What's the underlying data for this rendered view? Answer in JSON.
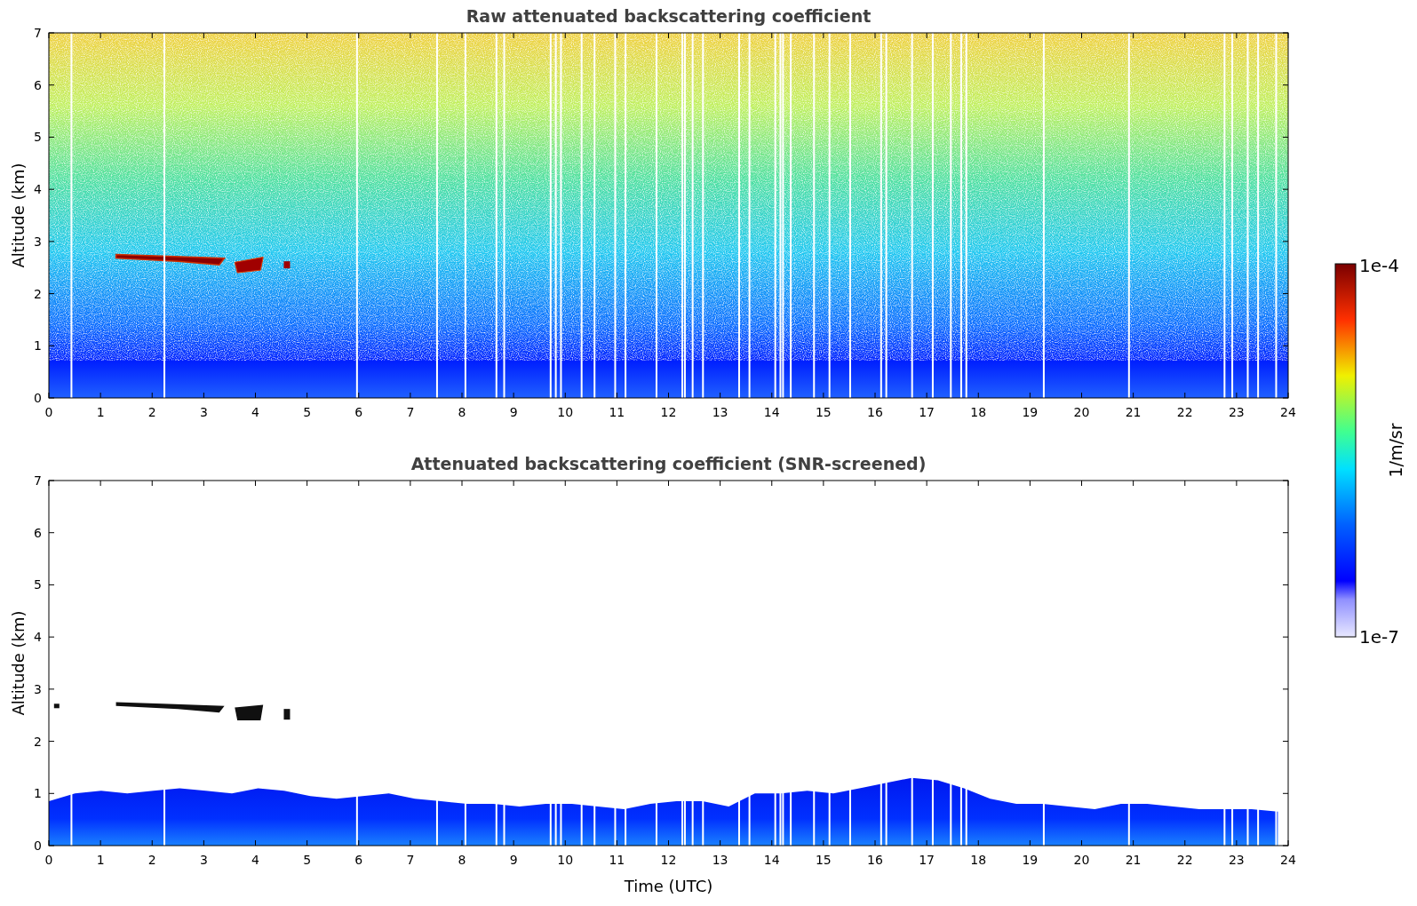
{
  "panels": [
    {
      "kind": "raw",
      "title": "Raw attenuated backscattering coefficient",
      "ylabel": "Altitude (km)",
      "yticks": [
        "7",
        "6",
        "5",
        "4",
        "3",
        "2",
        "1",
        "0"
      ],
      "xticks": [
        "0",
        "1",
        "2",
        "3",
        "4",
        "5",
        "6",
        "7",
        "8",
        "9",
        "10",
        "11",
        "12",
        "13",
        "14",
        "15",
        "16",
        "17",
        "18",
        "19",
        "20",
        "21",
        "22",
        "23",
        "24"
      ]
    },
    {
      "kind": "screened",
      "title": "Attenuated backscattering coefficient (SNR-screened)",
      "ylabel": "Altitude (km)",
      "xlabel": "Time (UTC)",
      "yticks": [
        "7",
        "6",
        "5",
        "4",
        "3",
        "2",
        "1",
        "0"
      ],
      "xticks": [
        "0",
        "1",
        "2",
        "3",
        "4",
        "5",
        "6",
        "7",
        "8",
        "9",
        "10",
        "11",
        "12",
        "13",
        "14",
        "15",
        "16",
        "17",
        "18",
        "19",
        "20",
        "21",
        "22",
        "23",
        "24"
      ]
    }
  ],
  "colorbar": {
    "label": "1/m/sr",
    "max_label": "1e-4",
    "min_label": "1e-7"
  }
}
